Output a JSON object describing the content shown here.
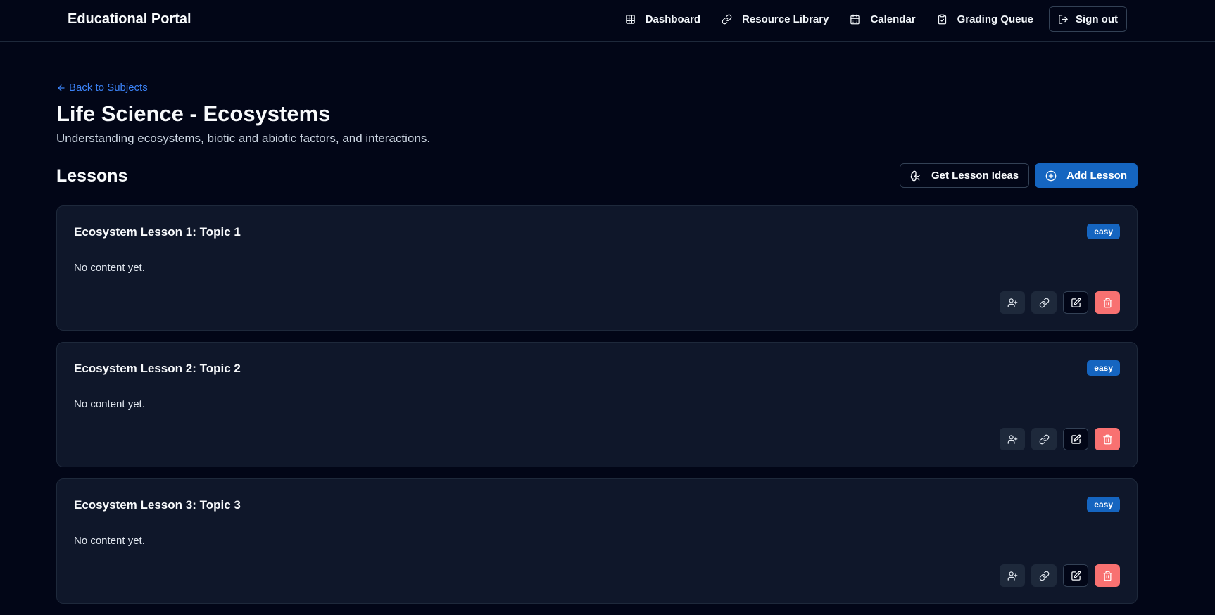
{
  "header": {
    "brand": "Educational Portal",
    "nav": [
      {
        "label": "Dashboard",
        "icon": "grid-icon"
      },
      {
        "label": "Resource Library",
        "icon": "link-icon"
      },
      {
        "label": "Calendar",
        "icon": "calendar-icon"
      },
      {
        "label": "Grading Queue",
        "icon": "clipboard-check-icon"
      }
    ],
    "signout_label": "Sign out"
  },
  "page": {
    "back_label": "Back to Subjects",
    "title": "Life Science - Ecosystems",
    "subtitle": "Understanding ecosystems, biotic and abiotic factors, and interactions."
  },
  "lessons": {
    "section_title": "Lessons",
    "get_ideas_label": "Get Lesson Ideas",
    "add_label": "Add Lesson",
    "items": [
      {
        "title": "Ecosystem Lesson 1: Topic 1",
        "difficulty": "easy",
        "content": "No content yet."
      },
      {
        "title": "Ecosystem Lesson 2: Topic 2",
        "difficulty": "easy",
        "content": "No content yet."
      },
      {
        "title": "Ecosystem Lesson 3: Topic 3",
        "difficulty": "easy",
        "content": "No content yet."
      }
    ]
  },
  "colors": {
    "background": "#020617",
    "card": "#0f172a",
    "primary": "#1565c0",
    "link": "#3b82f6",
    "danger": "#f87171"
  }
}
